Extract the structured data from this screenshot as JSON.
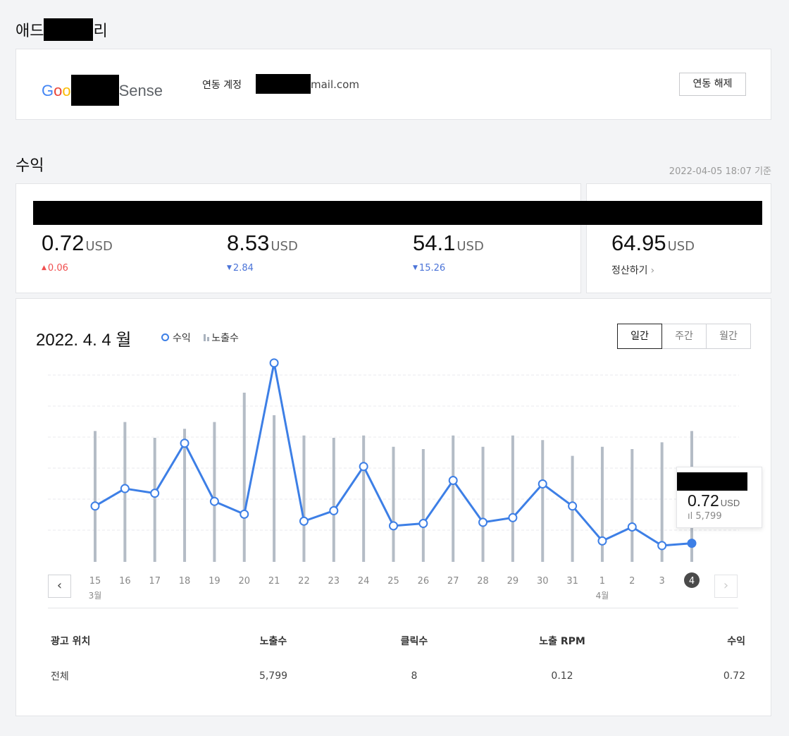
{
  "page": {
    "title_start": "애드",
    "title_end": "리"
  },
  "adsense": {
    "logo_prefix": "Goo",
    "logo_suffix": "Sense",
    "account_label": "연동 계정",
    "email_suffix": "mail.com",
    "unlink_label": "연동 해제"
  },
  "revenue": {
    "title": "수익",
    "as_of": "2022-04-05 18:07 기준",
    "stats": [
      {
        "value": "0.72",
        "unit": "USD",
        "delta": "0.06",
        "direction": "up"
      },
      {
        "value": "8.53",
        "unit": "USD",
        "delta": "2.84",
        "direction": "down"
      },
      {
        "value": "54.1",
        "unit": "USD",
        "delta": "15.26",
        "direction": "down"
      }
    ],
    "total": {
      "value": "64.95",
      "unit": "USD",
      "settle_label": "정산하기"
    }
  },
  "chart_header": {
    "date_title": "2022. 4. 4 월",
    "legend_revenue": "수익",
    "legend_impressions": "노출수",
    "tabs": [
      "일간",
      "주간",
      "월간"
    ],
    "active_tab": 0
  },
  "tooltip": {
    "value": "0.72",
    "unit": "USD",
    "impressions": "5,799"
  },
  "chart_data": {
    "type": "line",
    "categories": [
      "15",
      "16",
      "17",
      "18",
      "19",
      "20",
      "21",
      "22",
      "23",
      "24",
      "25",
      "26",
      "27",
      "28",
      "29",
      "30",
      "31",
      "1",
      "2",
      "3",
      "4"
    ],
    "month_labels": [
      {
        "index": 0,
        "label": "3월"
      },
      {
        "index": 17,
        "label": "4월"
      }
    ],
    "selected_index": 20,
    "y_gridlines": 6,
    "series": [
      {
        "name": "수익",
        "type": "line",
        "values": [
          0.48,
          0.63,
          0.59,
          1.02,
          0.52,
          0.41,
          1.71,
          0.35,
          0.44,
          0.82,
          0.31,
          0.33,
          0.7,
          0.34,
          0.38,
          0.67,
          0.48,
          0.18,
          0.3,
          0.14,
          0.16
        ]
      },
      {
        "name": "노출수",
        "type": "bar",
        "values": [
          5.8,
          6.2,
          5.5,
          5.9,
          6.2,
          7.5,
          6.5,
          5.6,
          5.5,
          5.6,
          5.1,
          5.0,
          5.6,
          5.1,
          5.6,
          5.4,
          4.7,
          5.1,
          5.0,
          5.3,
          5.8
        ]
      }
    ],
    "ylim": [
      0,
      2.0
    ],
    "bar_ylim": [
      0,
      10
    ]
  },
  "table": {
    "headers": [
      "광고 위치",
      "노출수",
      "클릭수",
      "노출 RPM",
      "수익"
    ],
    "rows": [
      [
        "전체",
        "5,799",
        "8",
        "0.12",
        "0.72"
      ]
    ]
  }
}
